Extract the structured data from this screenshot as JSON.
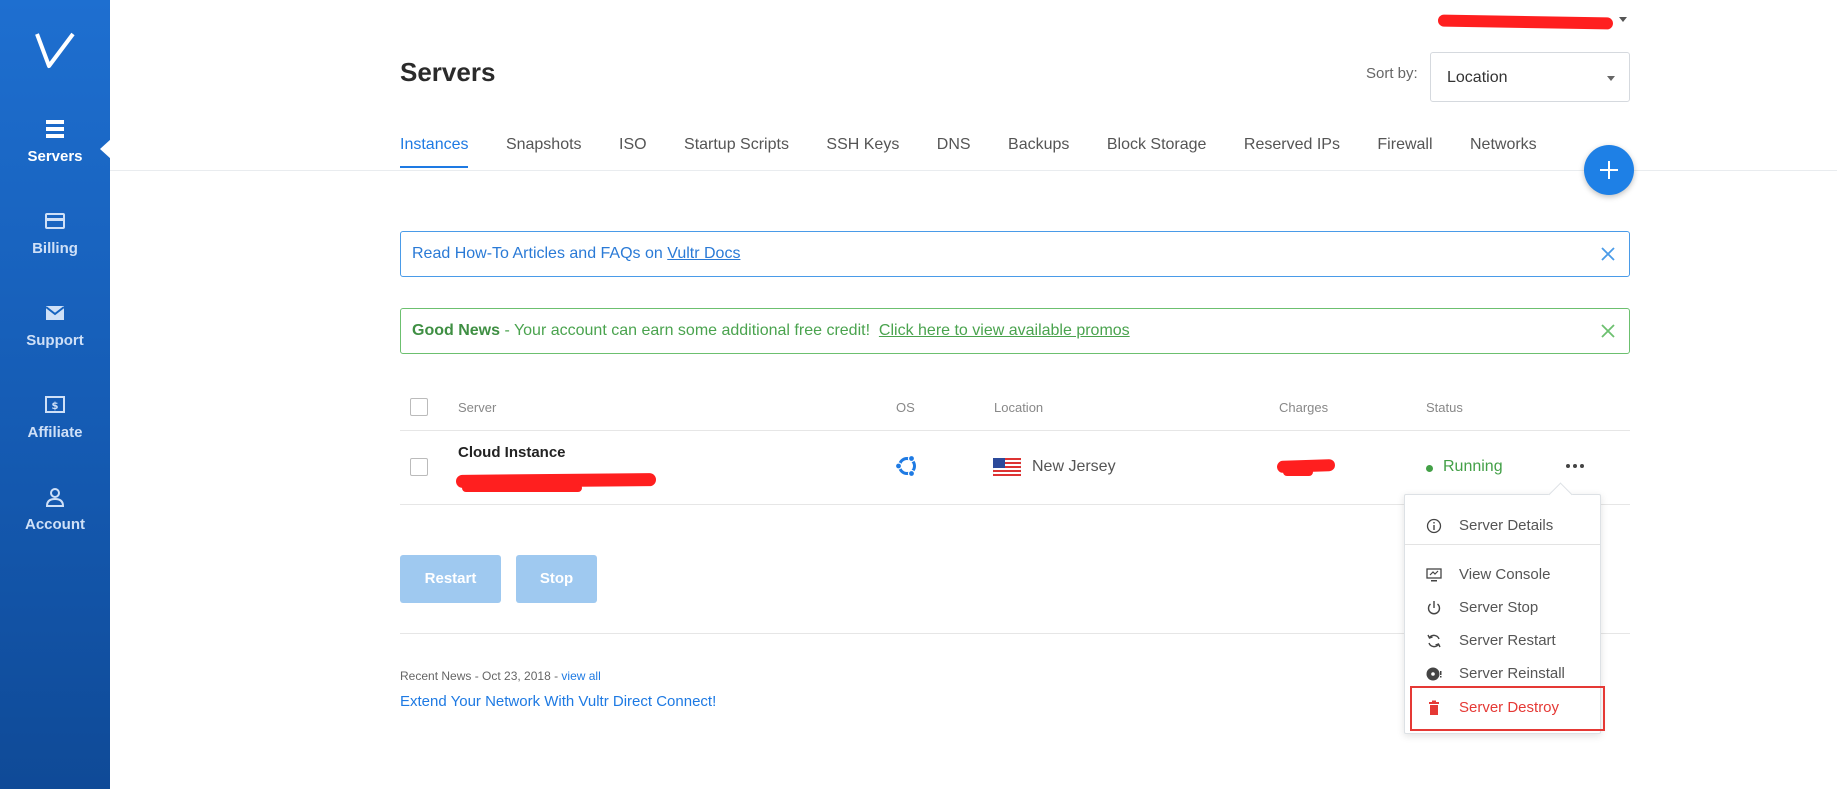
{
  "sidebar": {
    "items": [
      {
        "label": "Servers",
        "icon": "server-stack-icon",
        "active": true
      },
      {
        "label": "Billing",
        "icon": "credit-card-icon",
        "active": false
      },
      {
        "label": "Support",
        "icon": "envelope-icon",
        "active": false
      },
      {
        "label": "Affiliate",
        "icon": "dollar-bill-icon",
        "active": false
      },
      {
        "label": "Account",
        "icon": "user-icon",
        "active": false
      }
    ]
  },
  "header": {
    "title": "Servers",
    "sort_label": "Sort by:",
    "sort_value": "Location"
  },
  "tabs": [
    {
      "label": "Instances",
      "active": true
    },
    {
      "label": "Snapshots"
    },
    {
      "label": "ISO"
    },
    {
      "label": "Startup Scripts"
    },
    {
      "label": "SSH Keys"
    },
    {
      "label": "DNS"
    },
    {
      "label": "Backups"
    },
    {
      "label": "Block Storage"
    },
    {
      "label": "Reserved IPs"
    },
    {
      "label": "Firewall"
    },
    {
      "label": "Networks"
    }
  ],
  "alerts": {
    "info_text": "Read How-To Articles and FAQs on ",
    "info_link": "Vultr Docs",
    "good_title": "Good News",
    "good_text": " - Your account can earn some additional free credit!  ",
    "good_link": "Click here to view available promos"
  },
  "table": {
    "headers": {
      "server": "Server",
      "os": "OS",
      "location": "Location",
      "charges": "Charges",
      "status": "Status"
    },
    "rows": [
      {
        "name": "Cloud Instance",
        "os_icon": "ubuntu-icon",
        "location": "New Jersey",
        "flag": "us-flag-icon",
        "status": "Running"
      }
    ]
  },
  "actions": {
    "restart": "Restart",
    "stop": "Stop"
  },
  "news": {
    "meta": "Recent News - Oct 23, 2018 - ",
    "view_all": "view all",
    "title": "Extend Your Network With Vultr Direct Connect!"
  },
  "row_menu": {
    "items": [
      {
        "label": "Server Details",
        "icon": "info-circle-icon"
      },
      {
        "label": "View Console",
        "icon": "monitor-icon"
      },
      {
        "label": "Server Stop",
        "icon": "power-icon"
      },
      {
        "label": "Server Restart",
        "icon": "refresh-icon"
      },
      {
        "label": "Server Reinstall",
        "icon": "disc-icon"
      },
      {
        "label": "Server Destroy",
        "icon": "trash-icon"
      }
    ]
  },
  "colors": {
    "accent": "#1e7ae3",
    "sidebar": "#1563c0",
    "success": "#43a047",
    "danger": "#e53935"
  }
}
